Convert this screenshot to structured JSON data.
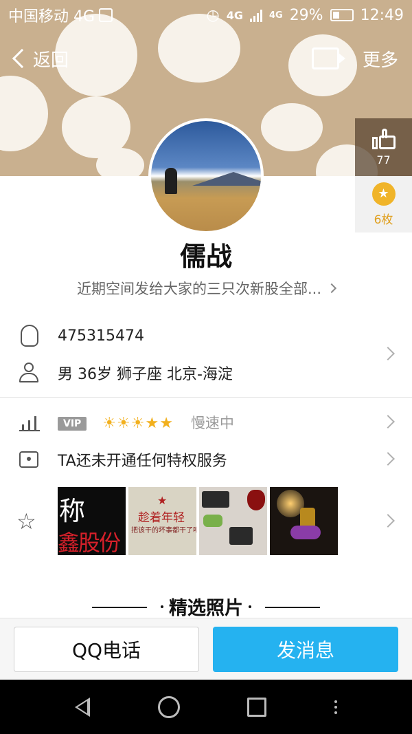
{
  "status_bar": {
    "carrier": "中国移动 4G",
    "network_a": "4G",
    "network_b": "4G",
    "battery": "29%",
    "time": "12:49"
  },
  "nav": {
    "back_label": "返回",
    "more_label": "更多"
  },
  "side": {
    "like_count": "77",
    "medal_count": "6枚"
  },
  "profile": {
    "nickname": "儒战",
    "signature": "近期空间发给大家的三只次新股全部..."
  },
  "info": {
    "qq_number": "475315474",
    "details": "男  36岁  狮子座  北京-海淀"
  },
  "vip": {
    "badge": "VIP",
    "level_icons": "☀☀☀★★",
    "speed": "慢速中"
  },
  "privilege": {
    "text": "TA还未开通任何特权服务"
  },
  "photos": {
    "p1_line1": "称",
    "p1_line2": "鑫股份",
    "p2_line1": "趁着年轻",
    "p2_line2": "把该干的坏事都干了吧"
  },
  "section": {
    "title": "精选照片"
  },
  "actions": {
    "call_label": "QQ电话",
    "message_label": "发消息"
  },
  "colors": {
    "banner": "#c9b08f",
    "primary_button": "#25b2f0",
    "medal": "#f0b429"
  }
}
